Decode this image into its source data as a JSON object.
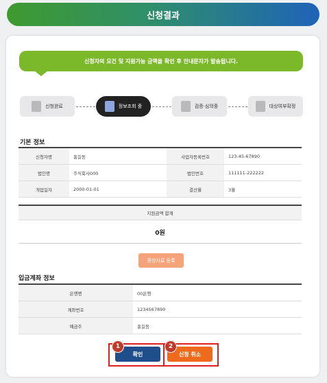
{
  "header": {
    "title": "신청결과"
  },
  "notice": "신청자의 요건 및 지원가능 금액을 확인 후 안내문자가 발송됩니다.",
  "steps": [
    {
      "label": "신청완료",
      "icon": "document-icon"
    },
    {
      "label": "정보조회 중",
      "icon": "search-document-icon"
    },
    {
      "label": "검증·심의중",
      "icon": "review-icon"
    },
    {
      "label": "대상여부확정",
      "icon": "confirm-icon"
    }
  ],
  "basic_info": {
    "title": "기본 정보",
    "rows": [
      {
        "l1": "신청자명",
        "v1": "홍길동",
        "l2": "사업자등록번호",
        "v2": "123-45-67890"
      },
      {
        "l1": "법인명",
        "v1": "주식회사000",
        "l2": "법인번호",
        "v2": "111111-222222"
      },
      {
        "l1": "개업일자",
        "v1": "2000-01-01",
        "l2": "결산월",
        "v2": "3월"
      }
    ]
  },
  "support_sum": {
    "label": "지원금액 합계",
    "value": "0원"
  },
  "evidence_button": "증빙자료 등록",
  "account_info": {
    "title": "입금계좌 정보",
    "rows": [
      {
        "label": "은행명",
        "value": "00은행"
      },
      {
        "label": "계좌번호",
        "value": "1234567890"
      },
      {
        "label": "예금주",
        "value": "홍길동"
      }
    ]
  },
  "buttons": {
    "confirm": "확인",
    "cancel": "신청 취소"
  },
  "markers": {
    "m1": "1",
    "m2": "2"
  },
  "colors": {
    "confirm": "#1f4e8c",
    "cancel": "#ef6a1c",
    "notice": "#7bb82a",
    "highlight": "#e02020"
  }
}
